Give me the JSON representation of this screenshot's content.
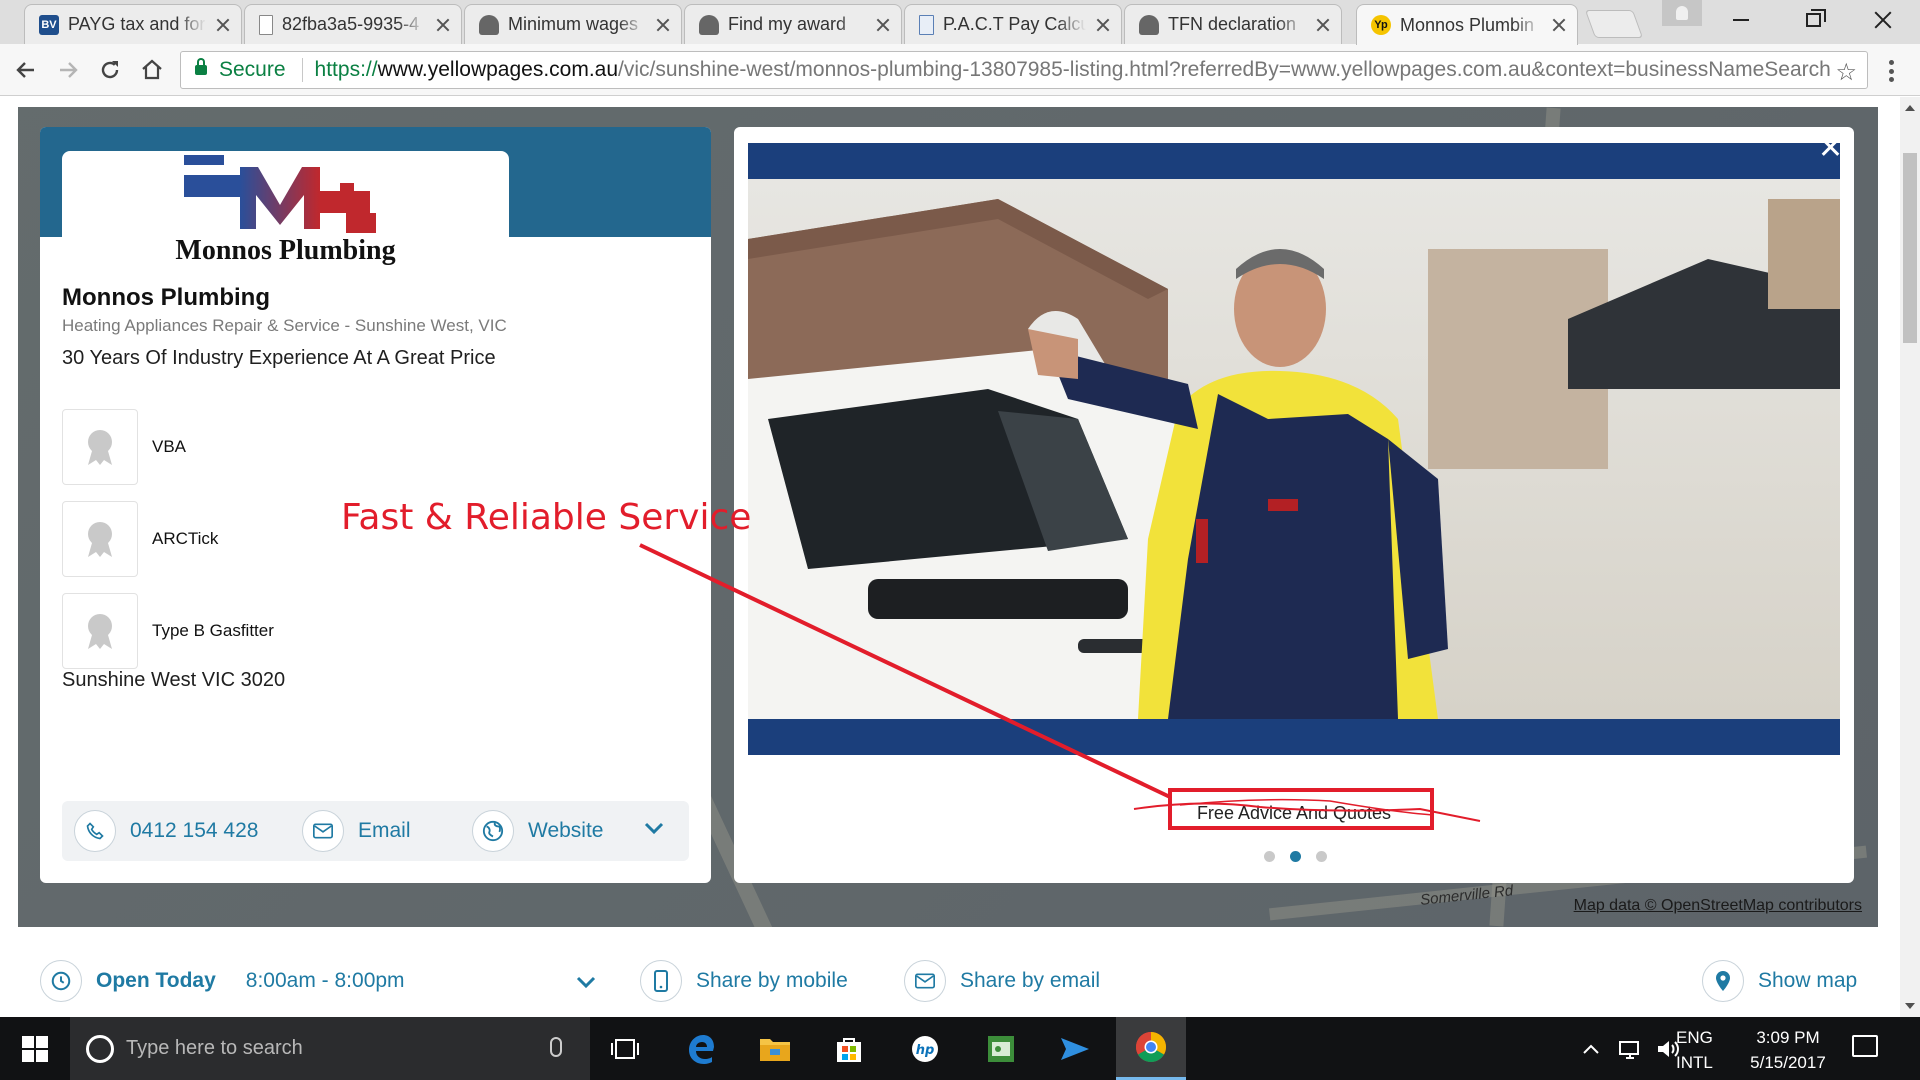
{
  "browser": {
    "tabs": [
      {
        "title": "PAYG tax and for",
        "favicon": "BV",
        "favicon_color": "#1f4e8c"
      },
      {
        "title": "82fba3a5-9935-4",
        "favicon": "doc-icon",
        "favicon_color": "#ffffff"
      },
      {
        "title": "Minimum wages",
        "favicon": "coat-of-arms-icon",
        "favicon_color": "#555555"
      },
      {
        "title": "Find my award",
        "favicon": "coat-of-arms-icon",
        "favicon_color": "#555555"
      },
      {
        "title": "P.A.C.T Pay Calcu",
        "favicon": "doc-icon",
        "favicon_color": "#5a7fb5"
      },
      {
        "title": "TFN declaration",
        "favicon": "coat-of-arms-icon",
        "favicon_color": "#555555"
      },
      {
        "title": "Monnos Plumbin",
        "favicon": "Yp",
        "favicon_color": "#f5c400",
        "active": true
      }
    ],
    "secure_label": "Secure",
    "url_scheme": "https://",
    "url_host": "www.yellowpages.com.au",
    "url_rest": "/vic/sunshine-west/monnos-plumbing-13807985-listing.html?referredBy=www.yellowpages.com.au&context=businessNameSearch"
  },
  "listing": {
    "logo_text": "Monnos Plumbing",
    "name": "Monnos Plumbing",
    "category": "Heating Appliances Repair & Service - Sunshine West, VIC",
    "tagline": "30 Years Of Industry Experience At A Great Price",
    "accreditations": [
      {
        "label": "VBA"
      },
      {
        "label": "ARCTick"
      },
      {
        "label": "Type B Gasfitter"
      }
    ],
    "address": "Sunshine West VIC 3020",
    "phone": "0412 154 428",
    "email_label": "Email",
    "website_label": "Website"
  },
  "gallery": {
    "caption": "Free Advice And Quotes",
    "slide_count": 3,
    "active_slide": 2
  },
  "map": {
    "attribution": "Map data © OpenStreetMap contributors",
    "street_label": "Somerville Rd"
  },
  "annotation": {
    "text": "Fast & Reliable Service",
    "color": "#e21d2b"
  },
  "infobar": {
    "open_label": "Open Today",
    "hours": "8:00am - 8:00pm",
    "share_mobile": "Share by mobile",
    "share_email": "Share by email",
    "show_map": "Show map"
  },
  "taskbar": {
    "search_placeholder": "Type here to search",
    "lang_top": "ENG",
    "lang_bottom": "INTL",
    "time": "3:09 PM",
    "date": "5/15/2017"
  },
  "colors": {
    "brand_blue": "#23678e",
    "link_blue": "#1f7aa3",
    "secure_green": "#0b8043"
  }
}
